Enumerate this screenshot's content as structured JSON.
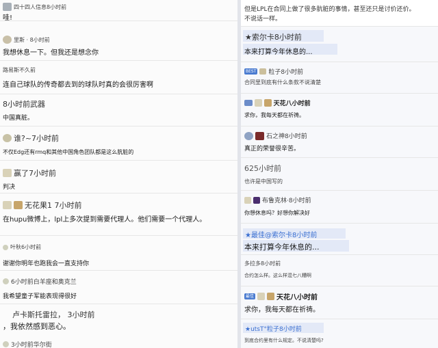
{
  "left": {
    "comments": [
      {
        "meta": "四十四人信息8小时前",
        "text": "哇!"
      },
      {
        "meta": "里斯 · 8小时前",
        "text": "我想休息一下。但我还是想念你"
      },
      {
        "meta": "路易斯不久前",
        "text": "连自己球队的传奇都去到的球队时真的会很厉害啊"
      },
      {
        "meta": "8小时前武器",
        "text": "中国真脏。"
      },
      {
        "meta": "谁?~7小时前",
        "text": "不仅Edg还有rmq和其他中国角色团队都是这么肮脏的"
      },
      {
        "meta": "赢了7小时前",
        "text": "判决"
      },
      {
        "meta": "无花果1 7小时前",
        "text": "在hupu微博上，lpl上多次提到需要代理人。他们需要一个代理人。"
      },
      {
        "meta": "叶秋6小时前",
        "text": "谢谢你明年也跑我会一直支持你"
      },
      {
        "meta": "6小时前白羊座和奥克兰",
        "text": "我希望童子军能表现得很好"
      },
      {
        "meta": "卢卡斯托雷拉， 3小时前",
        "text": "，我依然感到恶心。"
      },
      {
        "meta": "3小时前华尔街",
        "text": ""
      }
    ]
  },
  "right": {
    "items": [
      {
        "text": "但是LPL在合同上做了很多肮脏的事情，甚至还只是讨价还价。",
        "text2": "不说话一样。"
      },
      {
        "meta": "★索尔卡8小时前",
        "text": "本来打算今年休息的..."
      },
      {
        "badge": "BEST",
        "meta": "粒子8小时前",
        "text": "合同里到底有什么条款不说清楚"
      },
      {
        "meta": "天花八小时前",
        "text": "求你，我每天都在祈祷。"
      },
      {
        "meta": "石之神8小时前",
        "text": "真正的荣誉很辛苦。"
      },
      {
        "meta": "625小时前",
        "text": "也许是中国写的"
      },
      {
        "meta": "布鲁克林·8小时前",
        "text": "你想休息吗？好想你解决好"
      },
      {
        "meta": "★最佳@索尔卡8小时前",
        "text": "本来打算今年休息的..."
      },
      {
        "meta": "多拉多8小时前",
        "text": "合约怎么样。这么样混七八糟啊"
      },
      {
        "badge": "最佳",
        "meta": "天花八小时前",
        "text": "求你，我每天都在祈祷。"
      },
      {
        "meta": "★utsT°粒子8小时前",
        "text": "到底合约里有什么规定。不说清楚吗?"
      }
    ]
  }
}
